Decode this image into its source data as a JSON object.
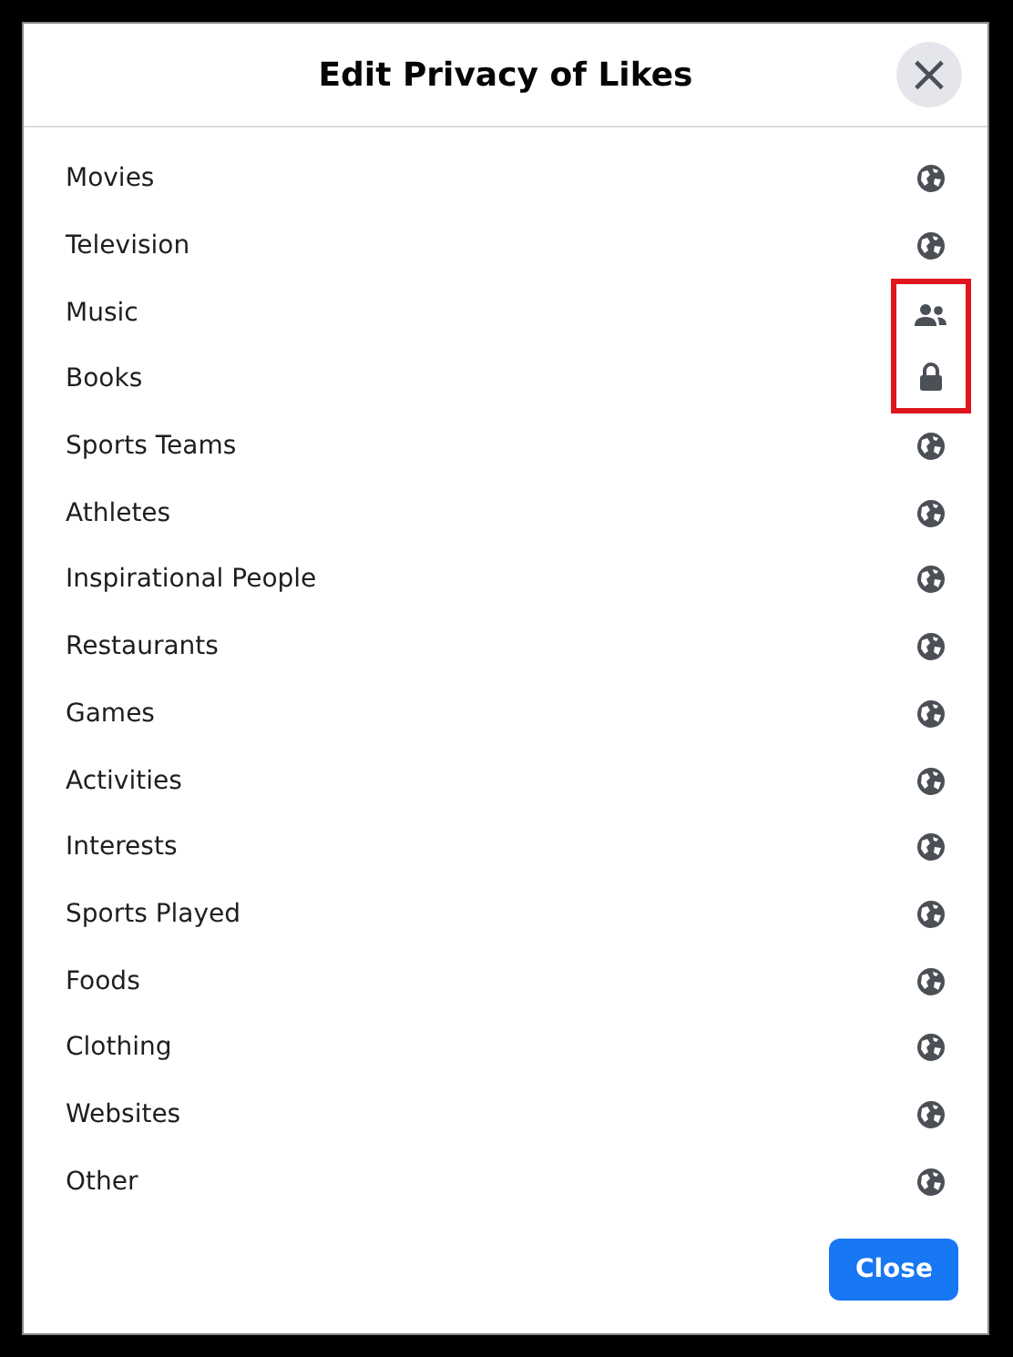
{
  "dialog": {
    "title": "Edit Privacy of Likes",
    "close_icon": "×"
  },
  "items": [
    {
      "label": "Movies",
      "kind": "public",
      "highlighted": false
    },
    {
      "label": "Television",
      "kind": "public",
      "highlighted": false
    },
    {
      "label": "Music",
      "kind": "friends",
      "highlighted": true
    },
    {
      "label": "Books",
      "kind": "private",
      "highlighted": true
    },
    {
      "label": "Sports Teams",
      "kind": "public",
      "highlighted": false
    },
    {
      "label": "Athletes",
      "kind": "public",
      "highlighted": false
    },
    {
      "label": "Inspirational People",
      "kind": "public",
      "highlighted": false
    },
    {
      "label": "Restaurants",
      "kind": "public",
      "highlighted": false
    },
    {
      "label": "Games",
      "kind": "public",
      "highlighted": false
    },
    {
      "label": "Activities",
      "kind": "public",
      "highlighted": false
    },
    {
      "label": "Interests",
      "kind": "public",
      "highlighted": false
    },
    {
      "label": "Sports Played",
      "kind": "public",
      "highlighted": false
    },
    {
      "label": "Foods",
      "kind": "public",
      "highlighted": false
    },
    {
      "label": "Clothing",
      "kind": "public",
      "highlighted": false
    },
    {
      "label": "Websites",
      "kind": "public",
      "highlighted": false
    },
    {
      "label": "Other",
      "kind": "public",
      "highlighted": false
    }
  ],
  "footer": {
    "button": "Close"
  }
}
